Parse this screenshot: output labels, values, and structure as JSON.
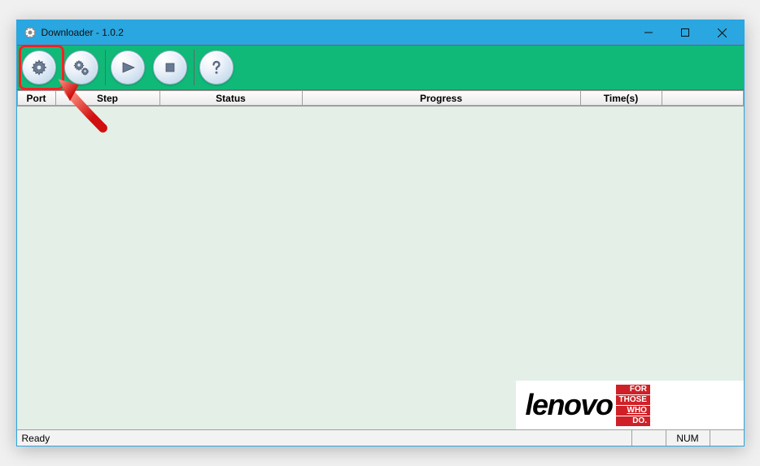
{
  "window": {
    "title": "Downloader - 1.0.2"
  },
  "toolbar": {
    "buttons": {
      "config": "config",
      "settings": "settings",
      "start": "start",
      "stop": "stop",
      "help": "help"
    }
  },
  "columns": {
    "port": "Port",
    "step": "Step",
    "status": "Status",
    "progress": "Progress",
    "time": "Time(s)",
    "tail": ""
  },
  "branding": {
    "logo_text": "lenovo",
    "tag1": "FOR",
    "tag2": "THOSE",
    "tag3": "WHO",
    "tag4": "DO."
  },
  "statusbar": {
    "ready": "Ready",
    "num": "NUM"
  }
}
